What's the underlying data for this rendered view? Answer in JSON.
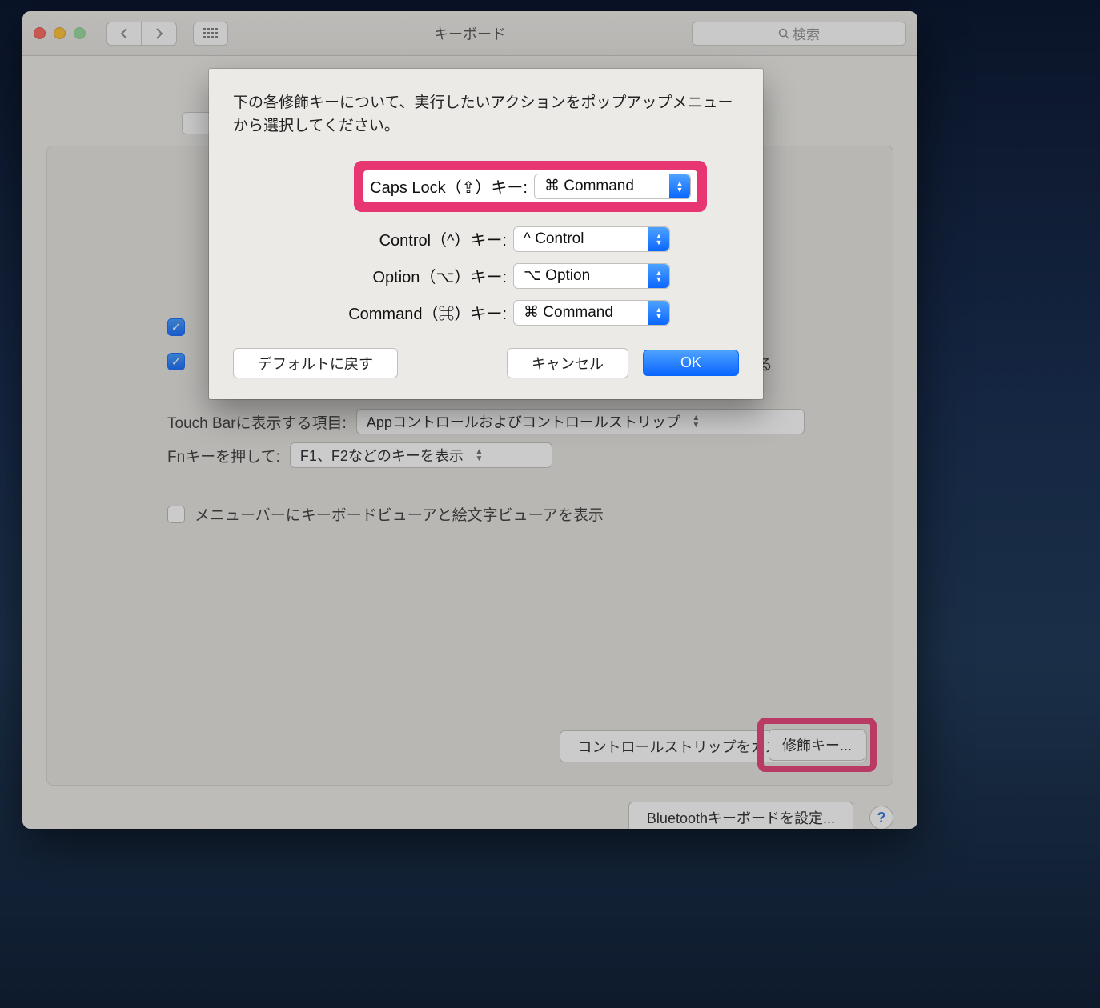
{
  "window": {
    "title": "キーボード",
    "search_placeholder": "検索"
  },
  "backdrop": {
    "checkbox1_trailing_text": "する",
    "touchbar_label": "Touch Barに表示する項目:",
    "touchbar_value": "Appコントロールおよびコントロールストリップ",
    "fn_label": "Fnキーを押して:",
    "fn_value": "F1、F2などのキーを表示",
    "menubar_checkbox_label": "メニューバーにキーボードビューアと絵文字ビューアを表示",
    "customize_strip_btn": "コントロールストリップをカスタマイズ...",
    "modifier_keys_btn": "修飾キー...",
    "bluetooth_btn": "Bluetoothキーボードを設定..."
  },
  "sheet": {
    "description": "下の各修飾キーについて、実行したいアクションをポップアップメニューから選択してください。",
    "rows": {
      "capslock": {
        "label": "Caps Lock（⇪）キー:",
        "value": "⌘ Command"
      },
      "control": {
        "label": "Control（^）キー:",
        "value": "^ Control"
      },
      "option": {
        "label": "Option（⌥）キー:",
        "value": "⌥ Option"
      },
      "command": {
        "label": "Command（⌘）キー:",
        "value": "⌘ Command"
      }
    },
    "buttons": {
      "restore": "デフォルトに戻す",
      "cancel": "キャンセル",
      "ok": "OK"
    }
  },
  "help_glyph": "?"
}
